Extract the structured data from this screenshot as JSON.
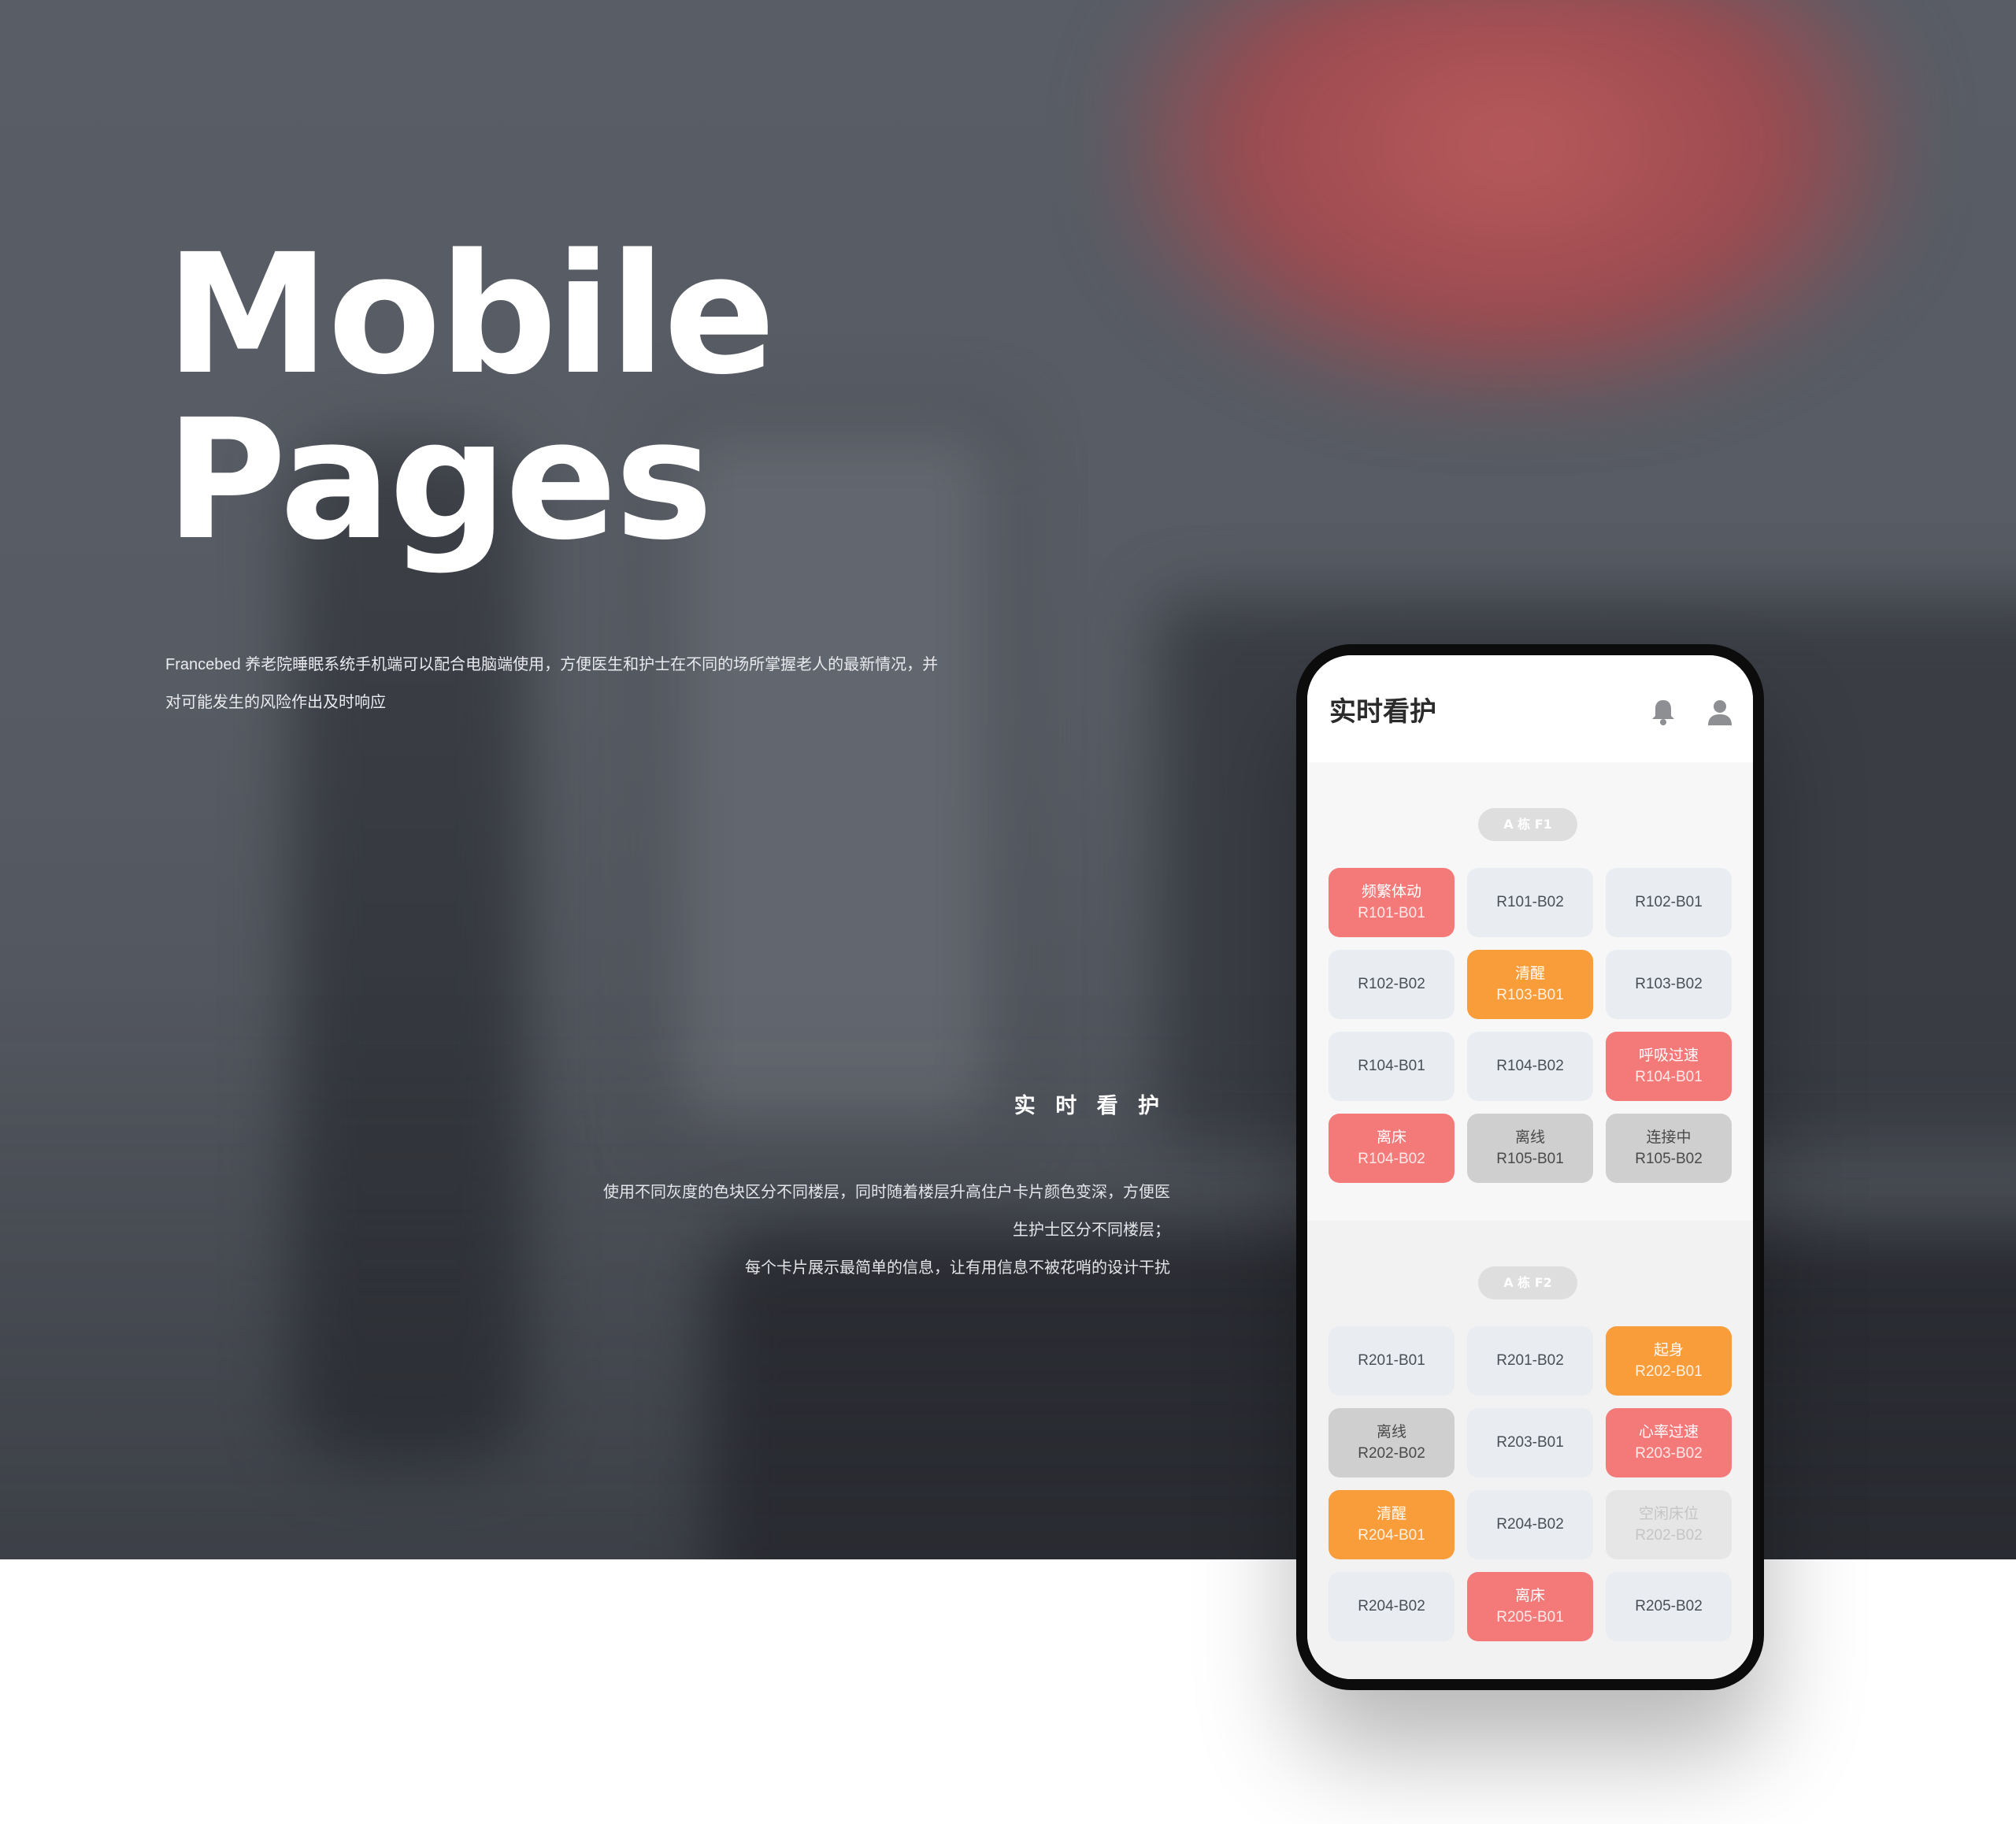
{
  "hero": {
    "title_line1": "Mobile",
    "title_line2": "Pages",
    "intro_line1": "Francebed  养老院睡眠系统手机端可以配合电脑端使用，方便医生和护士在不同的场所掌握老人的最新情况，并",
    "intro_line2": "对可能发生的风险作出及时响应"
  },
  "feature": {
    "title": "实 时 看 护",
    "desc_line1": "使用不同灰度的色块区分不同楼层，同时随着楼层升高住户卡片颜色变深，方便医",
    "desc_line2": "生护士区分不同楼层；",
    "desc_line3": "每个卡片展示最简单的信息，让有用信息不被花哨的设计干扰"
  },
  "phone": {
    "title": "实时看护",
    "icons": {
      "bell": "bell-icon",
      "user": "user-icon"
    },
    "floors": [
      {
        "label": "A 栋 F1",
        "beds": [
          {
            "status": "频繁体动",
            "id": "R101-B01",
            "tone": "pink"
          },
          {
            "status": "",
            "id": "R101-B02",
            "tone": "normal"
          },
          {
            "status": "",
            "id": "R102-B01",
            "tone": "normal"
          },
          {
            "status": "",
            "id": "R102-B02",
            "tone": "normal"
          },
          {
            "status": "清醒",
            "id": "R103-B01",
            "tone": "orange"
          },
          {
            "status": "",
            "id": "R103-B02",
            "tone": "normal"
          },
          {
            "status": "",
            "id": "R104-B01",
            "tone": "normal"
          },
          {
            "status": "",
            "id": "R104-B02",
            "tone": "normal"
          },
          {
            "status": "呼吸过速",
            "id": "R104-B01",
            "tone": "pink"
          },
          {
            "status": "离床",
            "id": "R104-B02",
            "tone": "pink"
          },
          {
            "status": "离线",
            "id": "R105-B01",
            "tone": "gray"
          },
          {
            "status": "连接中",
            "id": "R105-B02",
            "tone": "gray"
          }
        ]
      },
      {
        "label": "A 栋 F2",
        "beds": [
          {
            "status": "",
            "id": "R201-B01",
            "tone": "normal"
          },
          {
            "status": "",
            "id": "R201-B02",
            "tone": "normal"
          },
          {
            "status": "起身",
            "id": "R202-B01",
            "tone": "orange"
          },
          {
            "status": "离线",
            "id": "R202-B02",
            "tone": "gray"
          },
          {
            "status": "",
            "id": "R203-B01",
            "tone": "normal"
          },
          {
            "status": "心率过速",
            "id": "R203-B02",
            "tone": "pink"
          },
          {
            "status": "清醒",
            "id": "R204-B01",
            "tone": "orange"
          },
          {
            "status": "",
            "id": "R204-B02",
            "tone": "normal"
          },
          {
            "status": "空闲床位",
            "id": "R202-B02",
            "tone": "idle"
          },
          {
            "status": "",
            "id": "R204-B02",
            "tone": "normal"
          },
          {
            "status": "离床",
            "id": "R205-B01",
            "tone": "pink"
          },
          {
            "status": "",
            "id": "R205-B02",
            "tone": "normal"
          }
        ]
      }
    ]
  },
  "colors": {
    "alert_pink": "#f47a7a",
    "awake_orange": "#f99c3a",
    "offline_gray": "#cfcfd0",
    "normal_card": "#e9edf1"
  }
}
